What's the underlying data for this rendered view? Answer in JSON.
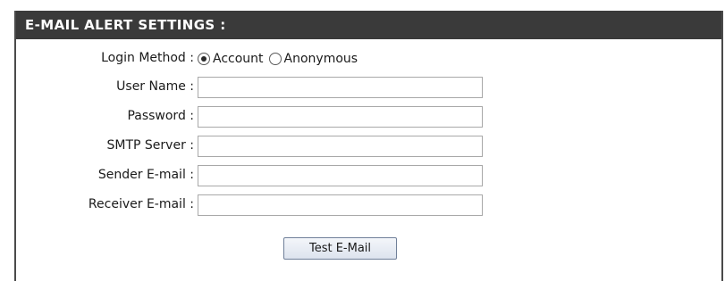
{
  "header": {
    "title": "E-MAIL ALERT SETTINGS :"
  },
  "form": {
    "login_method": {
      "label": "Login Method :",
      "options": [
        {
          "label": "Account",
          "selected": true
        },
        {
          "label": "Anonymous",
          "selected": false
        }
      ]
    },
    "user_name": {
      "label": "User Name :",
      "value": ""
    },
    "password": {
      "label": "Password :",
      "value": ""
    },
    "smtp_server": {
      "label": "SMTP Server :",
      "value": ""
    },
    "sender_email": {
      "label": "Sender E-mail :",
      "value": ""
    },
    "receiver_email": {
      "label": "Receiver E-mail :",
      "value": ""
    }
  },
  "actions": {
    "test_label": "Test E-Mail"
  },
  "colors": {
    "header_bg": "#3a3a3a",
    "header_text": "#ffffff",
    "field_border": "#a8a8a8"
  },
  "icons": {
    "radio_checked": "radio-checked-icon",
    "radio_unchecked": "radio-unchecked-icon"
  }
}
